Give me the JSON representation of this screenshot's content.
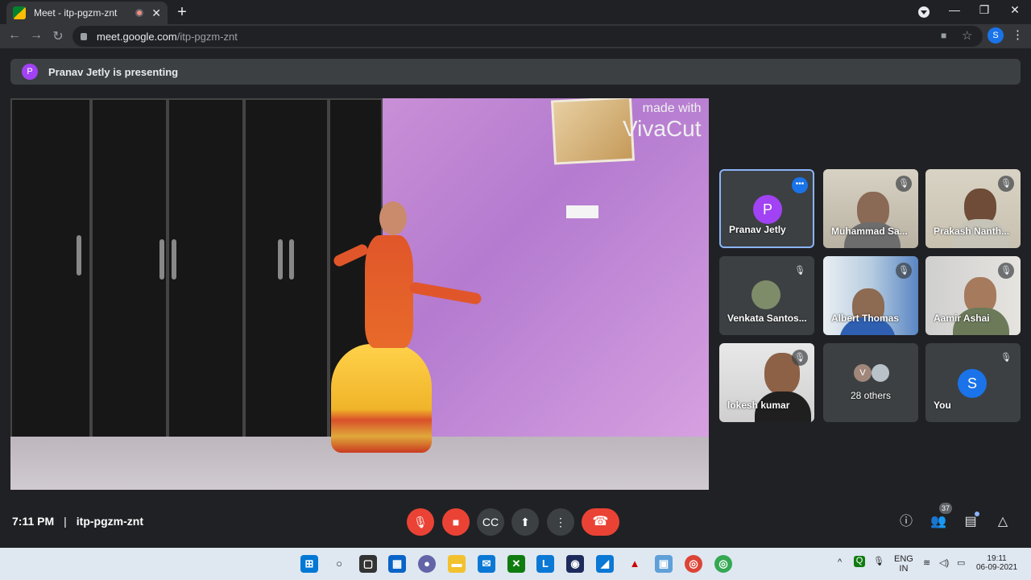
{
  "browser": {
    "tab_title": "Meet - itp-pgzm-znt",
    "tab_close": "✕",
    "new_tab": "+",
    "url_host": "meet.google.com",
    "url_path": "/itp-pgzm-znt",
    "profile_initial": "S",
    "window_controls": [
      "—",
      "❐",
      "✕"
    ]
  },
  "meet": {
    "presenting_initial": "P",
    "presenting_text": "Pranav Jetly is presenting",
    "watermark_line1": "made with",
    "watermark_line2": "VivaCut",
    "tiles": [
      {
        "name": "Pranav Jetly",
        "type": "avatar",
        "initial": "P",
        "color": "#a142f4",
        "speaking": true
      },
      {
        "name": "Muhammad Sa...",
        "type": "photo",
        "muted": true
      },
      {
        "name": "Prakash Nanth...",
        "type": "photo",
        "muted": true
      },
      {
        "name": "Venkata Santos...",
        "type": "small-photo",
        "muted": true
      },
      {
        "name": "Albert Thomas",
        "type": "photo",
        "muted": true
      },
      {
        "name": "Aamir Ashai",
        "type": "photo",
        "muted": true
      },
      {
        "name": "lokesh kumar",
        "type": "photo",
        "muted": true
      },
      {
        "name": "28 others",
        "type": "others",
        "initial": "V"
      },
      {
        "name": "You",
        "type": "avatar",
        "initial": "S",
        "color": "#1a73e8",
        "muted": true
      }
    ],
    "time": "7:11 PM",
    "separator": "|",
    "meeting_code": "itp-pgzm-znt",
    "participant_count": "37"
  },
  "taskbar": {
    "lang_line1": "ENG",
    "lang_line2": "IN",
    "clock_time": "19:11",
    "clock_date": "06-09-2021"
  }
}
